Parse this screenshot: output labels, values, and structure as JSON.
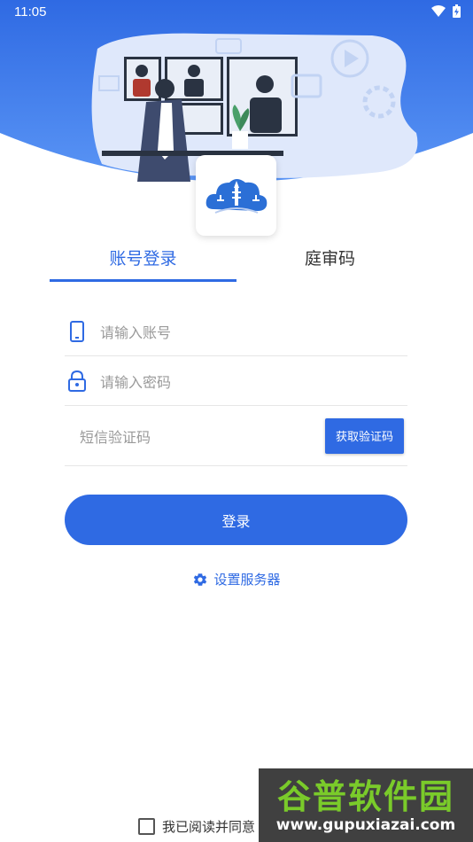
{
  "status_bar": {
    "time": "11:05",
    "icons": [
      "wifi-icon",
      "battery-charging-icon"
    ]
  },
  "colors": {
    "primary": "#2f6ae3",
    "header_bg": "#3b82f0",
    "placeholder": "#9a9a9a"
  },
  "tabs": [
    {
      "label": "账号登录",
      "active": true
    },
    {
      "label": "庭审码",
      "active": false
    }
  ],
  "form": {
    "account_placeholder": "请输入账号",
    "password_placeholder": "请输入密码",
    "sms_placeholder": "短信验证码",
    "sms_button": "获取验证码"
  },
  "login_button": "登录",
  "server_settings": "设置服务器",
  "agreement": {
    "text": "我已阅读并同意",
    "checked": false
  },
  "watermark": {
    "title": "谷普软件园",
    "url": "www.gupuxiazai.com"
  }
}
